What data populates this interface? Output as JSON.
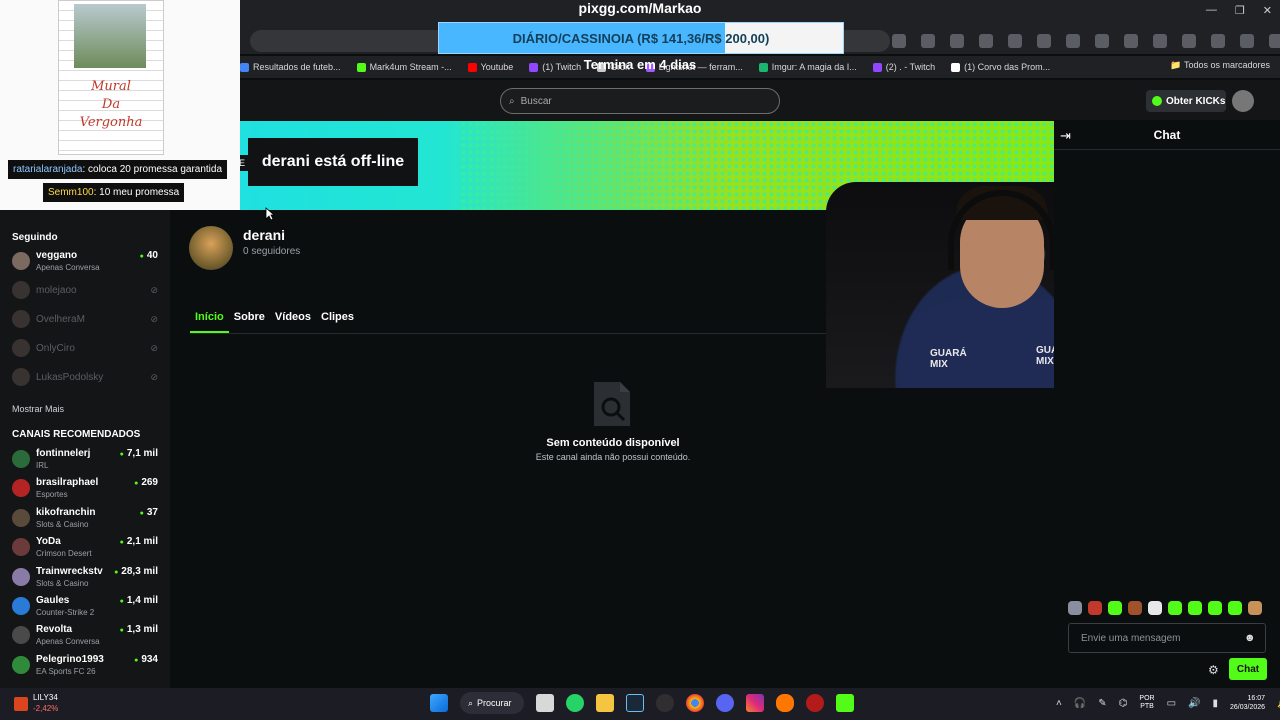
{
  "overlay": {
    "title": "pixgg.com/Markao",
    "goal_text": "DIÁRIO/CASSINOIA (R$ 141,36/R$ 200,00)",
    "goal_progress": 0.7068,
    "goal_subtitle": "Termina em 4 dias",
    "mural_text_1": "Mural",
    "mural_text_2": "Da",
    "mural_text_3": "Vergonha",
    "chat_messages": [
      {
        "user": "ratarialaranjada",
        "text": ": coloca 20 promessa garantida"
      },
      {
        "user": "Semm100",
        "text": ": 10 meu promessa"
      }
    ]
  },
  "browser": {
    "bookmarks": [
      {
        "label": "Resultados de futeb...",
        "color": "#4285f4"
      },
      {
        "label": "Mark4um Stream -...",
        "color": "#53fc18"
      },
      {
        "label": "Youtube",
        "color": "#ff0000"
      },
      {
        "label": "(1) Twitch",
        "color": "#9146ff"
      },
      {
        "label": "Grok",
        "color": "#cccccc"
      },
      {
        "label": "Lightshot — ferram...",
        "color": "#a259ff"
      },
      {
        "label": "Imgur: A magia da I...",
        "color": "#1bb76e"
      },
      {
        "label": "(2) . - Twitch",
        "color": "#9146ff"
      },
      {
        "label": "(1) Corvo das Prom...",
        "color": "#ffffff"
      }
    ],
    "all_bookmarks": "Todos os marcadores"
  },
  "kick": {
    "search_placeholder": "Buscar",
    "get_kicks": "Obter KICKs",
    "following_header": "Seguindo",
    "following": [
      {
        "name": "veggano",
        "category": "Apenas Conversa",
        "viewers": "40",
        "online": true
      },
      {
        "name": "molejaoo",
        "online": false
      },
      {
        "name": "OvelheraM",
        "online": false
      },
      {
        "name": "OnlyCiro",
        "online": false
      },
      {
        "name": "LukasPodolsky",
        "online": false
      }
    ],
    "show_more": "Mostrar Mais",
    "recommended_header": "CANAIS RECOMENDADOS",
    "recommended": [
      {
        "name": "fontinnelerj",
        "category": "IRL",
        "viewers": "7,1 mil",
        "color": "#2b6b3a"
      },
      {
        "name": "brasilraphael",
        "category": "Esportes",
        "viewers": "269",
        "color": "#b52424"
      },
      {
        "name": "kikofranchin",
        "category": "Slots & Casino",
        "viewers": "37",
        "color": "#5a4a3a"
      },
      {
        "name": "YoDa",
        "category": "Crimson Desert",
        "viewers": "2,1 mil",
        "color": "#6b3a3a"
      },
      {
        "name": "Trainwreckstv",
        "category": "Slots & Casino",
        "viewers": "28,3 mil",
        "color": "#8a7aa8"
      },
      {
        "name": "Gaules",
        "category": "Counter-Strike 2",
        "viewers": "1,4 mil",
        "color": "#2a7ad8"
      },
      {
        "name": "Revolta",
        "category": "Apenas Conversa",
        "viewers": "1,3 mil",
        "color": "#4a4a4a"
      },
      {
        "name": "Pelegrino1993",
        "category": "EA Sports FC 26",
        "viewers": "934",
        "color": "#2f8a3a"
      }
    ],
    "offline_banner": "derani está off-line",
    "channel_name": "derani",
    "followers": "0 seguidores",
    "tabs": [
      "Início",
      "Sobre",
      "Vídeos",
      "Clipes"
    ],
    "empty_title": "Sem conteúdo disponível",
    "empty_subtitle": "Este canal ainda não possui conteúdo.",
    "chat_title": "Chat",
    "chat_placeholder": "Envie uma mensagem",
    "chat_send": "Chat",
    "webcam_logo": "GUARÁ MIX"
  },
  "taskbar": {
    "ticker_name": "LILY34",
    "ticker_value": "-2,42%",
    "search_label": "Procurar",
    "lang_1": "POR",
    "lang_2": "PTB",
    "time": "16:07",
    "date": "26/03/2026"
  },
  "colors": {
    "kick_green": "#53fc18",
    "goal_fill": "#49b7ff"
  }
}
